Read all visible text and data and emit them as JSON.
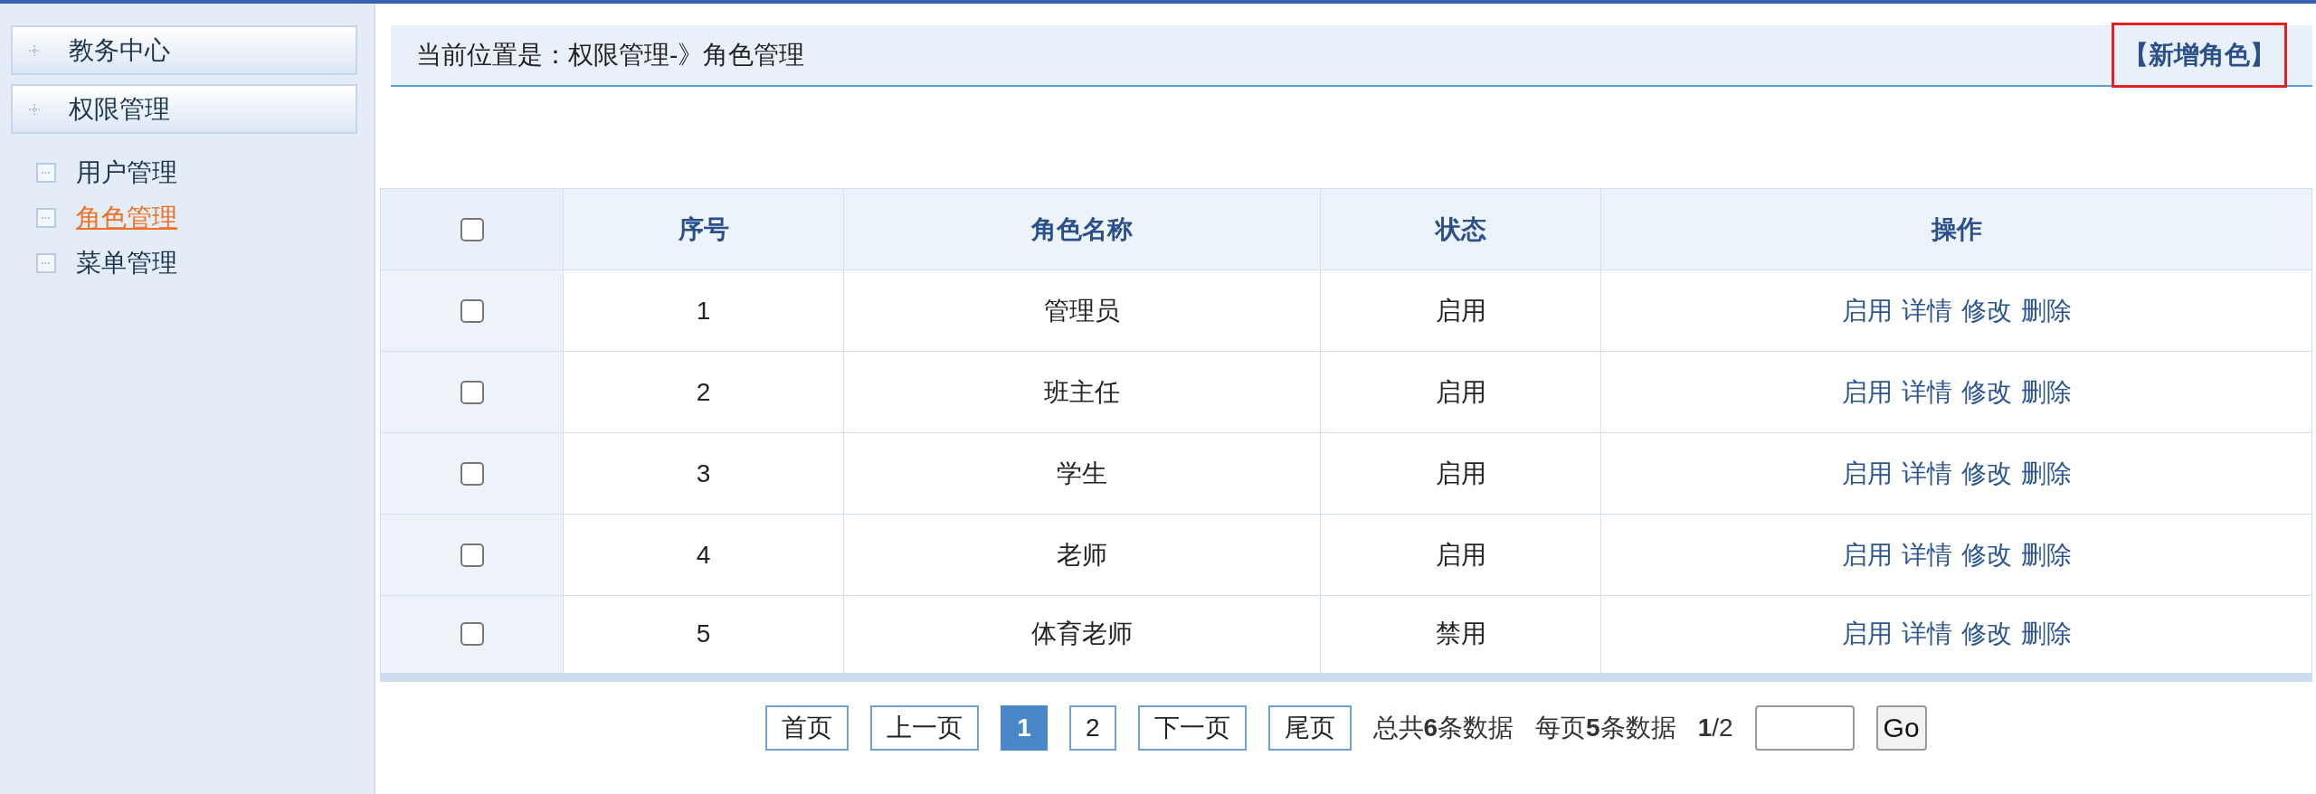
{
  "sidebar": {
    "groups": [
      {
        "label": "教务中心"
      },
      {
        "label": "权限管理"
      }
    ],
    "items": [
      {
        "label": "用户管理",
        "selected": false
      },
      {
        "label": "角色管理",
        "selected": true
      },
      {
        "label": "菜单管理",
        "selected": false
      }
    ]
  },
  "breadcrumb": "当前位置是：权限管理-》角色管理",
  "add_button": {
    "label": "【新增角色】",
    "highlighted": true
  },
  "table": {
    "header_checkbox": {
      "checked": false
    },
    "columns": [
      "序号",
      "角色名称",
      "状态",
      "操作"
    ],
    "rows": [
      {
        "checked": false,
        "index": "1",
        "name": "管理员",
        "status": "启用",
        "actions": [
          "启用",
          "详情",
          "修改",
          "删除"
        ]
      },
      {
        "checked": false,
        "index": "2",
        "name": "班主任",
        "status": "启用",
        "actions": [
          "启用",
          "详情",
          "修改",
          "删除"
        ]
      },
      {
        "checked": false,
        "index": "3",
        "name": "学生",
        "status": "启用",
        "actions": [
          "启用",
          "详情",
          "修改",
          "删除"
        ]
      },
      {
        "checked": false,
        "index": "4",
        "name": "老师",
        "status": "启用",
        "actions": [
          "启用",
          "详情",
          "修改",
          "删除"
        ]
      },
      {
        "checked": false,
        "index": "5",
        "name": "体育老师",
        "status": "禁用",
        "actions": [
          "启用",
          "详情",
          "修改",
          "删除"
        ]
      }
    ]
  },
  "pagination": {
    "first": "首页",
    "prev": "上一页",
    "pages": [
      {
        "label": "1",
        "selected": true
      },
      {
        "label": "2",
        "selected": false
      }
    ],
    "next": "下一页",
    "last": "尾页",
    "summary": [
      "总共**6**条数据",
      "每页**5**条数据",
      "**1**/2"
    ],
    "go": "Go"
  }
}
